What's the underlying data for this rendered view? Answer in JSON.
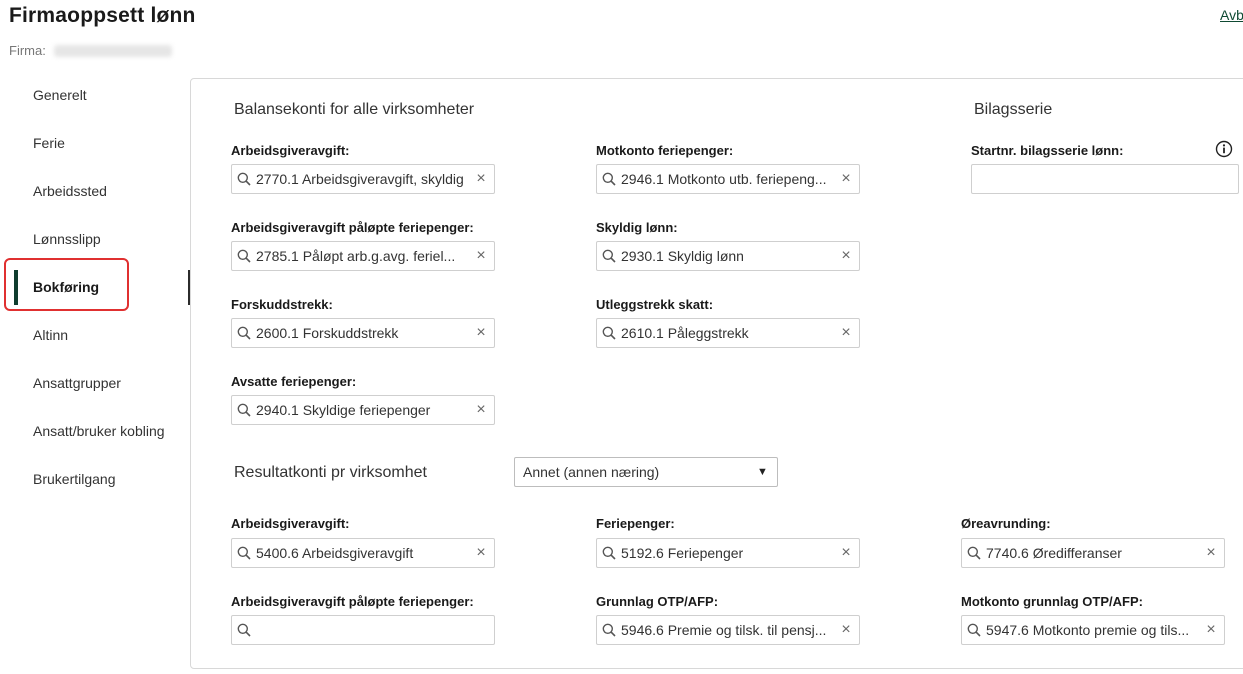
{
  "header": {
    "title": "Firmaoppsett lønn",
    "cancel_label": "Avb",
    "firm_label": "Firma:"
  },
  "sidebar": {
    "items": [
      {
        "label": "Generelt"
      },
      {
        "label": "Ferie"
      },
      {
        "label": "Arbeidssted"
      },
      {
        "label": "Lønnsslipp"
      },
      {
        "label": "Bokføring"
      },
      {
        "label": "Altinn"
      },
      {
        "label": "Ansattgrupper"
      },
      {
        "label": "Ansatt/bruker kobling"
      },
      {
        "label": "Brukertilgang"
      }
    ],
    "active": "Bokføring"
  },
  "balance": {
    "title": "Balansekonti for alle virksomheter",
    "fields": [
      {
        "label": "Arbeidsgiveravgift:",
        "value": "2770.1 Arbeidsgiveravgift, skyldig"
      },
      {
        "label": "Motkonto feriepenger:",
        "value": "2946.1 Motkonto utb. feriepeng..."
      },
      {
        "label": "Arbeidsgiveravgift påløpte feriepenger:",
        "value": "2785.1 Påløpt arb.g.avg. feriel..."
      },
      {
        "label": "Skyldig lønn:",
        "value": "2930.1 Skyldig lønn"
      },
      {
        "label": "Forskuddstrekk:",
        "value": "2600.1 Forskuddstrekk"
      },
      {
        "label": "Utleggstrekk skatt:",
        "value": "2610.1 Påleggstrekk"
      },
      {
        "label": "Avsatte feriepenger:",
        "value": "2940.1 Skyldige feriepenger"
      }
    ]
  },
  "bilag": {
    "title": "Bilagsserie",
    "label": "Startnr. bilagsserie lønn:",
    "value": ""
  },
  "result": {
    "title": "Resultatkonti pr virksomhet",
    "selected": "Annet (annen næring)",
    "fields": [
      {
        "label": "Arbeidsgiveravgift:",
        "value": "5400.6 Arbeidsgiveravgift"
      },
      {
        "label": "Feriepenger:",
        "value": "5192.6 Feriepenger"
      },
      {
        "label": "Øreavrunding:",
        "value": "7740.6 Øredifferanser"
      },
      {
        "label": "Arbeidsgiveravgift påløpte feriepenger:",
        "value": ""
      },
      {
        "label": "Grunnlag OTP/AFP:",
        "value": "5946.6 Premie og tilsk. til pensj..."
      },
      {
        "label": "Motkonto grunnlag OTP/AFP:",
        "value": "5947.6 Motkonto premie og tils..."
      }
    ]
  },
  "icons": {
    "search": "search-icon",
    "clear": "close-icon",
    "info": "info-icon",
    "caret": "caret-down-icon"
  },
  "colors": {
    "accent": "#0f3d2e",
    "highlight": "#e03030"
  }
}
